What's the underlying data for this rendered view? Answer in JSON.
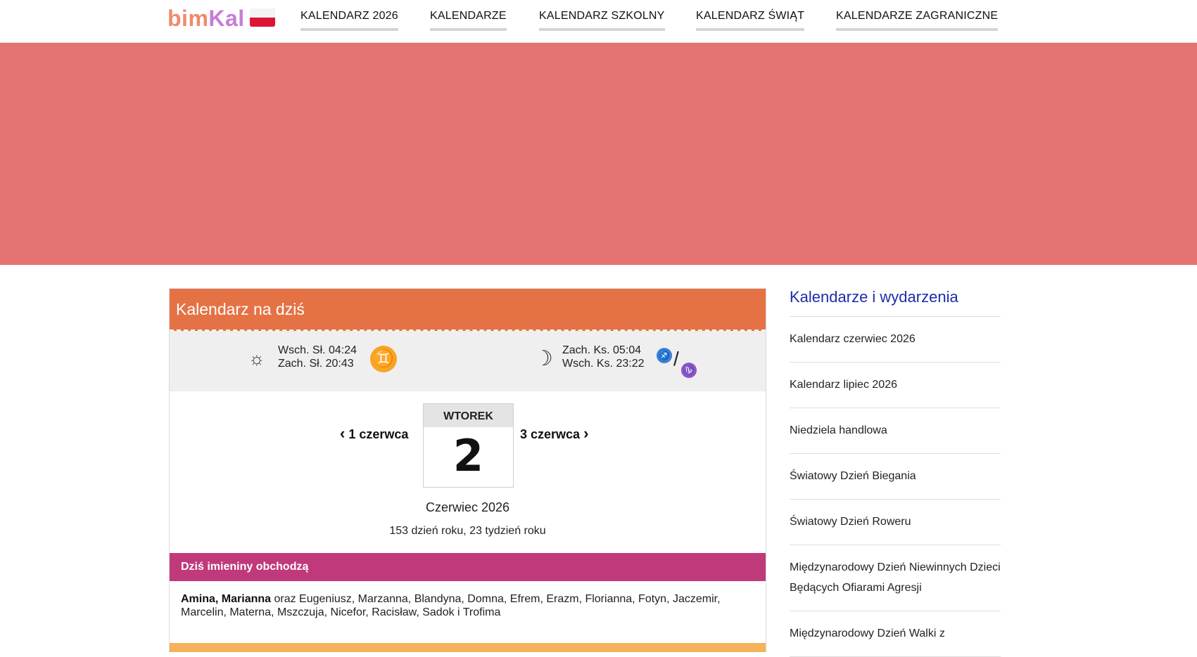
{
  "header": {
    "logo_part1": "bim",
    "logo_part2": "Kal",
    "flag": "poland-flag",
    "nav": [
      {
        "label": "KALENDARZ 2026"
      },
      {
        "label": "KALENDARZE"
      },
      {
        "label": "KALENDARZ SZKOLNY"
      },
      {
        "label": "KALENDARZ ŚWIĄT"
      },
      {
        "label": "KALENDARZE ZAGRANICZNE"
      }
    ]
  },
  "banner": {
    "color": "#e57373"
  },
  "today": {
    "title": "Kalendarz na dziś",
    "sun": {
      "icon": "sun-icon",
      "rise": "Wsch. Sł. 04:24",
      "set": "Zach. Sł. 20:43",
      "zodiac": "♊"
    },
    "moon": {
      "icon": "moon-icon",
      "set": "Zach. Ks. 05:04",
      "rise": "Wsch. Ks. 23:22",
      "zodiac1": "♐",
      "separator": "/",
      "zodiac2": "♑"
    },
    "prev_label": "1 czerwca",
    "next_label": "3 czerwca",
    "weekday": "WTOREK",
    "day": "2",
    "month_year": "Czerwiec 2026",
    "year_info": "153 dzień roku, 23 tydzień roku"
  },
  "names": {
    "heading": "Dziś imieniny obchodzą",
    "main": "Amina, Marianna",
    "rest": " oraz Eugeniusz, Marzanna, Blandyna, Domna, Efrem, Erazm, Florianna, Fotyn, Jaczemir, Marcelin, Materna, Mszczuja, Nicefor, Racisław, Sadok i Trofima"
  },
  "sidebar": {
    "title": "Kalendarze i wydarzenia",
    "items": [
      {
        "label": "Kalendarz czerwiec 2026"
      },
      {
        "label": "Kalendarz lipiec 2026"
      },
      {
        "label": "Niedziela handlowa"
      },
      {
        "label": "Światowy Dzień Biegania"
      },
      {
        "label": "Światowy Dzień Roweru"
      },
      {
        "label": "Międzynarodowy Dzień Niewinnych Dzieci Będących Ofiarami Agresji"
      },
      {
        "label": "Międzynarodowy Dzień Walki z"
      }
    ]
  }
}
